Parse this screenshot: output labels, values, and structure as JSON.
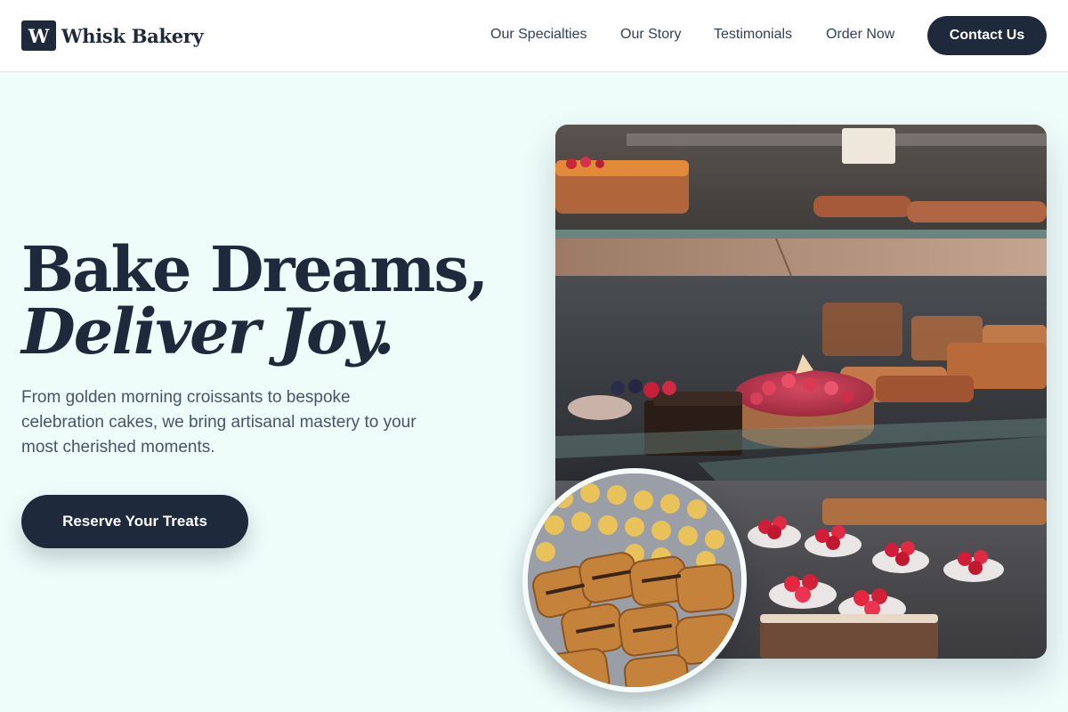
{
  "brand": {
    "logo_letter": "W",
    "name": "Whisk Bakery"
  },
  "nav": {
    "links": [
      "Our Specialties",
      "Our Story",
      "Testimonials",
      "Order Now"
    ],
    "contact_label": "Contact Us"
  },
  "hero": {
    "headline_line1": "Bake Dreams,",
    "headline_line2": "Deliver Joy.",
    "subtext": "From golden morning croissants to bespoke celebration cakes, we bring artisanal mastery to your most cherished moments.",
    "cta_label": "Reserve Your Treats"
  },
  "images": {
    "main": "bakery-display-case-photo",
    "circle": "pastry-tray-photo"
  },
  "colors": {
    "primary": "#1e293b",
    "background": "#eefcfa",
    "text_muted": "#475569"
  }
}
